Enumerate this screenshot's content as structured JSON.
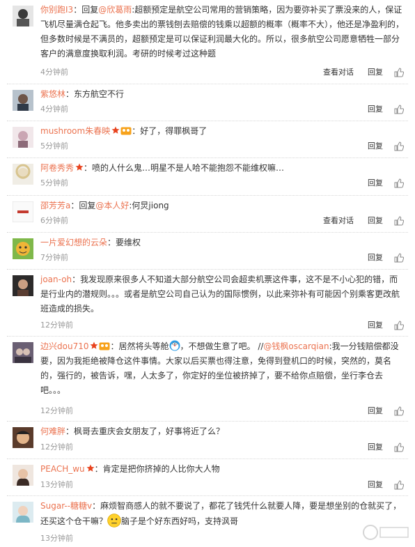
{
  "colors": {
    "nick": "#eb7350",
    "text": "#333333",
    "meta": "#999999",
    "star": "#e8421d"
  },
  "actions": {
    "view_conversation": "查看对话",
    "reply": "回复"
  },
  "comments": [
    {
      "nick": "你别跑I3",
      "text_a": "：回复",
      "mention": "@欣葛雨",
      "text_b": ":超额预定是航空公司常用的营销策略，因为要弥补买了票没来的人，保证飞机尽量满仓起飞。他多卖出的票钱刨去赔偿的钱乘以超额的概率（概率不大），他还是净盈利的，但多数时候是不满员的，超额预定是可以保证利润最大化的。所以，很多航空公司愿意牺牲一部分客户的满意度换取利润。考研的时候考过这种题",
      "time": "4分钟前"
    },
    {
      "nick": "紫悠林",
      "text": "：东方航空不行",
      "time": "4分钟前"
    },
    {
      "nick": "mushroom朱春映",
      "text": "：好了，得罪枫哥了",
      "time": "5分钟前"
    },
    {
      "nick": "阿卷秀秀",
      "text": "：喷的人什么鬼…明星不是人哈不能抱怨不能维权嘛…",
      "time": "5分钟前"
    },
    {
      "nick": "邵芳芳a",
      "text_a": "：回复",
      "mention": "@本人好",
      "text_b": ":何炅jiong",
      "time": "6分钟前"
    },
    {
      "nick": "一片爱幻想的云朵",
      "text": "：要维权",
      "time": "7分钟前"
    },
    {
      "nick": "joan-oh",
      "text": "：我发现原来很多人不知道大部分航空公司会超卖机票这件事，这不是不小心犯的错，而是行业内的潜规则。。。或者是航空公司自己认为的国际惯例，以此来弥补有可能因个别乘客更改航班造成的损失。",
      "time": "12分钟前"
    },
    {
      "nick": "边兴dou710",
      "text_a": "：居然将头等舱",
      "text_b": "，不想做生意了吧。 //",
      "mention": "@钱枫oscarqian",
      "text_c": ":我一分钱赔偿都没要，因为我拒绝被降仓这件事情。大家以后买票也得注意，免得到登机口的时候，突然的，莫名的，强行的，被告诉，嘿，人太多了，你定好的坐位被挤掉了，要不给你点赔偿，坐行李仓去吧。。。",
      "time": "12分钟前"
    },
    {
      "nick": "何难胖",
      "text": "：枫哥去重庆会女朋友了，好事将近了么？",
      "time": "12分钟前"
    },
    {
      "nick": "PEACH_wu",
      "text": "：肯定是把你挤掉的人比你大人物",
      "time": "13分钟前"
    },
    {
      "nick": "Sugar--糖糖v",
      "text_a": "：麻烦智商感人的就不要说了，都花了钱凭什么就要人降，要是想坐别的仓就买了，还买这个仓干嘛？",
      "text_b": "脑子是个好东西好吗，支持沨哥",
      "time": "13分钟前"
    }
  ]
}
